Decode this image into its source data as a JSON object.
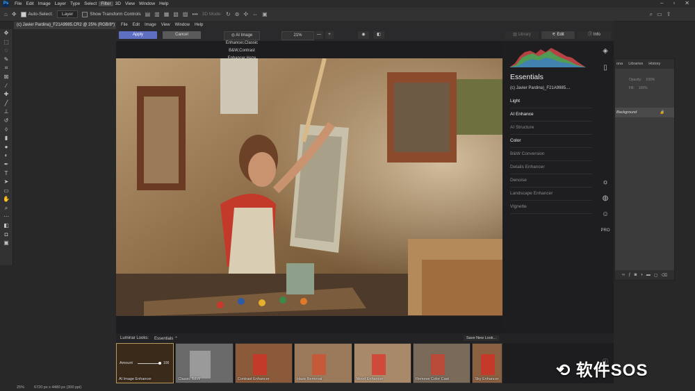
{
  "ps_menu": [
    "File",
    "Edit",
    "Image",
    "Layer",
    "Type",
    "Select",
    "Filter",
    "3D",
    "View",
    "Window",
    "Help"
  ],
  "ps_options": {
    "auto_select_label": "Auto-Select:",
    "layer_value": "Layer",
    "transform_label": "Show Transform Controls",
    "mode_3d": "3D Mode:"
  },
  "doc_tab": "(c) Javier Pardina)_F21A9985.CR2 @ 25% (RGB/8*)",
  "status": {
    "zoom": "25%",
    "info": "6720 px x 4480 px (300 ppi)"
  },
  "ps_panels": {
    "tabs": [
      "ona",
      "Libraries",
      "History"
    ],
    "opacity_label": "Opacity:",
    "opacity_value": "100%",
    "fill_label": "Fill:",
    "fill_value": "100%",
    "layer_name": "Background"
  },
  "luminar": {
    "menu": [
      "File",
      "Edit",
      "Image",
      "View",
      "Window",
      "Help"
    ],
    "apply": "Apply",
    "cancel": "Cancel",
    "looks": [
      "AI Image Enhancer",
      "Classic B&W",
      "Contrast Enhancer",
      "Haze Removal",
      "Mood Enhancer",
      "Remove Color Cast",
      "Sky Enhancer"
    ],
    "zoom": "21%",
    "minus": "—",
    "plus": "+",
    "tabs": {
      "library": "Library",
      "edit": "Edit",
      "info": "Info"
    },
    "panel_title": "Essentials",
    "file_name": "(c) Javier Pardina)_F21A9985....",
    "tools": [
      {
        "label": "Light",
        "bright": true
      },
      {
        "label": "AI Enhance",
        "bright": true
      },
      {
        "label": "AI Structure",
        "bright": false
      },
      {
        "label": "Color",
        "bright": true
      },
      {
        "label": "B&W Conversion",
        "bright": false
      },
      {
        "label": "Details Enhancer",
        "bright": false
      },
      {
        "label": "Denoise",
        "bright": false
      },
      {
        "label": "Landscape Enhancer",
        "bright": false
      },
      {
        "label": "Vignette",
        "bright": false
      }
    ],
    "pro_label": "PRO",
    "looks_label": "Luminar Looks:",
    "looks_category": "Essentials",
    "save_look": "Save New Look...",
    "amount_label": "Amount",
    "amount_value": "100"
  },
  "watermark": "软件SOS",
  "colors": {
    "apply": "#5e6ec0",
    "accent": "#b99a5a"
  }
}
